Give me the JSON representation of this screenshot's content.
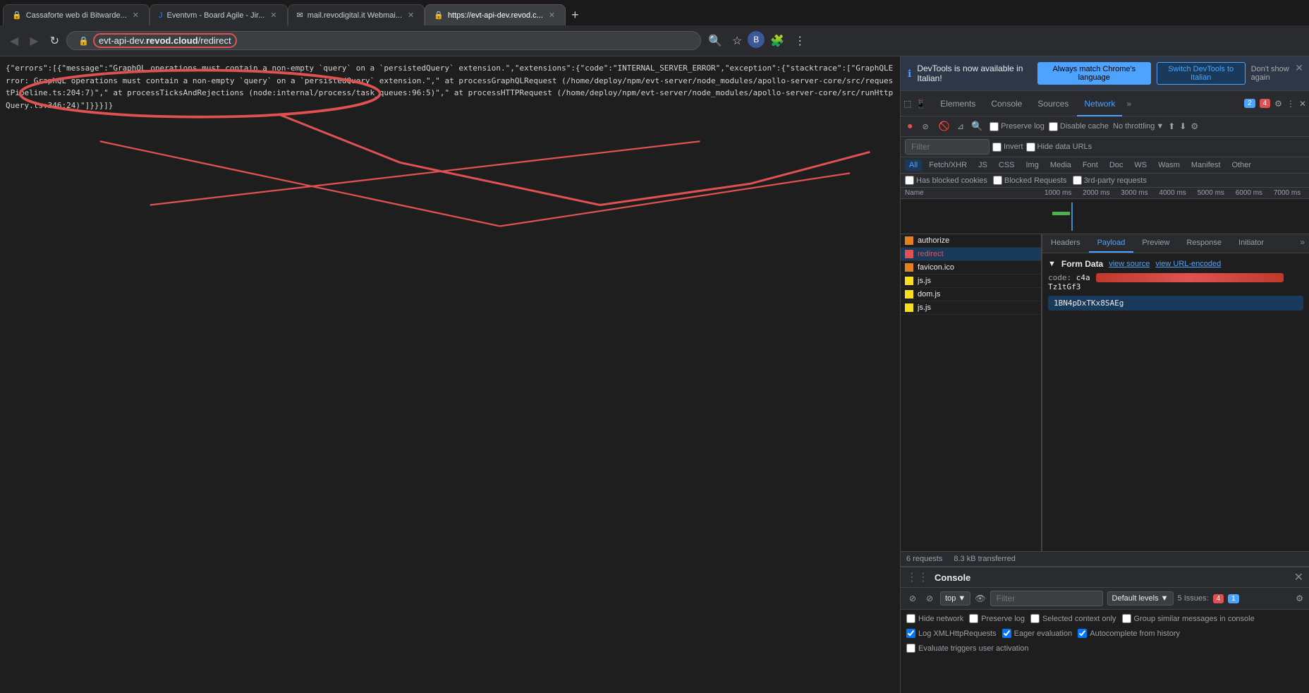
{
  "browser": {
    "tabs": [
      {
        "id": "tab1",
        "title": "Cassaforte web di Bitwarde...",
        "favicon": "🔒",
        "active": false
      },
      {
        "id": "tab2",
        "title": "Eventvm - Board Agile - Jir...",
        "favicon": "🔵",
        "active": false
      },
      {
        "id": "tab3",
        "title": "mail.revodigital.it Webmai...",
        "favicon": "✉",
        "active": false
      },
      {
        "id": "tab4",
        "title": "https://evt-api-dev.revod.c...",
        "favicon": "🔒",
        "active": true
      }
    ],
    "addressBar": {
      "url": "evt-api-dev.revod.cloud/redirect",
      "protocol": "https://",
      "domain": "evt-api-dev.revod.cloud",
      "path": "/redirect"
    }
  },
  "page": {
    "errorJson": "{\"errors\":[{\"message\":\"GraphQL operations must contain a non-empty `query` on a `persistedQuery` extension.\",\"extensions\":{\"code\":\"INTERNAL_SERVER_ERROR\",\"exception\":{\"stacktrace\":[\"GraphQLError: GraphQL operations must contain a non-empty `query` on a `persistedQuery` extension.\",\" at processGraphQLRequest (/home/deploy/npm/evt-server/node_modules/apollo-server-core/src/requestPipeline.ts:204:7)\",\" at processTicksAndRejections (node:internal/process/task_queues:96:5)\",\" at processHTTPRequest (/home/deploy/npm/evt-server/node_modules/apollo-server-core/src/runHttpQuery.ts:346:24)\"]}}}]}"
  },
  "devtools": {
    "notification": {
      "text": "DevTools is now available in Italian!",
      "btn1": "Always match Chrome's language",
      "btn2": "Switch DevTools to Italian",
      "btn3": "Don't show again"
    },
    "tabs": [
      "Elements",
      "Console",
      "Sources",
      "Network",
      "»"
    ],
    "activeTab": "Network",
    "network": {
      "toolbar": {
        "record": "⏺",
        "stop": "🚫",
        "clear": "🚫",
        "filter_placeholder": "Filter",
        "preserve_log": "Preserve log",
        "disable_cache": "Disable cache",
        "no_throttling": "No throttling",
        "invert": "Invert",
        "hide_data_urls": "Hide data URLs"
      },
      "filter_types": [
        "All",
        "Fetch/XHR",
        "JS",
        "CSS",
        "Img",
        "Media",
        "Font",
        "Doc",
        "WS",
        "Wasm",
        "Manifest",
        "Other"
      ],
      "checkboxes": {
        "has_blocked_cookies": "Has blocked cookies",
        "blocked_requests": "Blocked Requests",
        "third_party": "3rd-party requests"
      },
      "timeline": {
        "ticks": [
          "1000 ms",
          "2000 ms",
          "3000 ms",
          "4000 ms",
          "5000 ms",
          "6000 ms",
          "7000 ms"
        ]
      },
      "requests": [
        {
          "name": "authorize",
          "type": "xhr",
          "status": "normal",
          "favicon": "orange"
        },
        {
          "name": "redirect",
          "type": "xhr",
          "status": "error",
          "favicon": "orange"
        },
        {
          "name": "favicon.ico",
          "type": "img",
          "status": "normal",
          "favicon": "orange"
        },
        {
          "name": "js.js",
          "type": "js",
          "status": "normal",
          "favicon": "yellow"
        },
        {
          "name": "dom.js",
          "type": "js",
          "status": "normal",
          "favicon": "yellow"
        },
        {
          "name": "js.js",
          "type": "js",
          "status": "normal",
          "favicon": "yellow"
        }
      ],
      "detail": {
        "tabs": [
          "Headers",
          "Payload",
          "Preview",
          "Response",
          "Initiator",
          "»"
        ],
        "activeTab": "Payload",
        "formData": {
          "title": "Form Data",
          "link1": "view source",
          "link2": "view URL-encoded",
          "fields": [
            {
              "name": "code:",
              "value": "c4a... [REDACTED] ...Tz1tGf3\n1BN4pDxTKx8SAEg"
            }
          ]
        }
      },
      "status": {
        "requests": "6 requests",
        "transferred": "8.3 kB transferred"
      }
    },
    "console": {
      "title": "Console",
      "toolbar": {
        "top": "top",
        "filter_placeholder": "Filter",
        "default_levels": "Default levels ▼",
        "issues": "5 Issues:",
        "issues_count1": "4",
        "issues_count2": "1"
      },
      "options": [
        {
          "label": "Hide network",
          "checked": false
        },
        {
          "label": "Preserve log",
          "checked": false
        },
        {
          "label": "Selected context only",
          "checked": false
        },
        {
          "label": "Group similar messages in console",
          "checked": false
        },
        {
          "label": "Log XMLHttpRequests",
          "checked": true
        },
        {
          "label": "Eager evaluation",
          "checked": true
        },
        {
          "label": "Autocomplete from history",
          "checked": true
        },
        {
          "label": "Evaluate triggers user activation",
          "checked": false
        }
      ]
    }
  }
}
